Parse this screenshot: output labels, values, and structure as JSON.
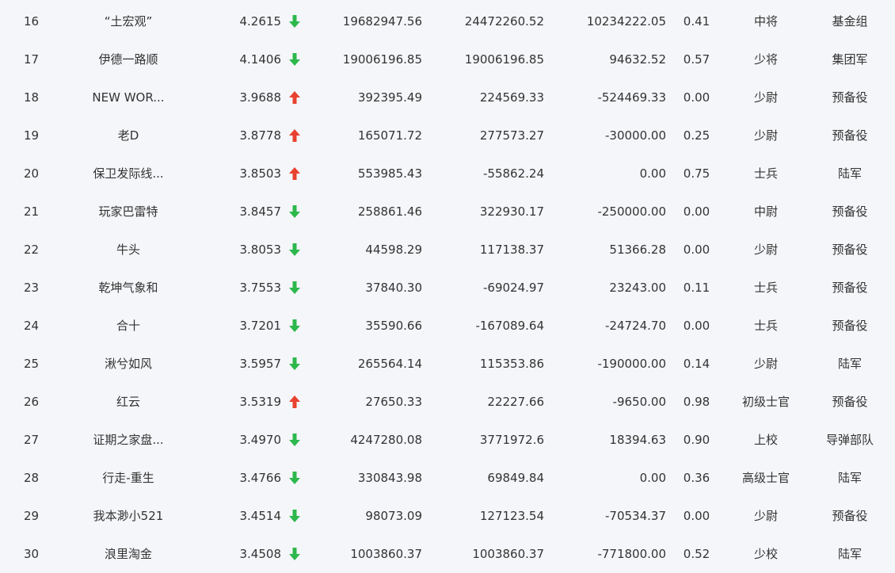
{
  "colors": {
    "up": "#e8412f",
    "down": "#2cb84c"
  },
  "rows": [
    {
      "rank": "16",
      "name": "“土宏观”",
      "score": "4.2615",
      "trend": "down",
      "v1": "19682947.56",
      "v2": "24472260.52",
      "v3": "10234222.05",
      "ratio": "0.41",
      "level": "中将",
      "unit": "基金组"
    },
    {
      "rank": "17",
      "name": "伊德一路顺",
      "score": "4.1406",
      "trend": "down",
      "v1": "19006196.85",
      "v2": "19006196.85",
      "v3": "94632.52",
      "ratio": "0.57",
      "level": "少将",
      "unit": "集团军"
    },
    {
      "rank": "18",
      "name": "NEW WOR...",
      "score": "3.9688",
      "trend": "up",
      "v1": "392395.49",
      "v2": "224569.33",
      "v3": "-524469.33",
      "ratio": "0.00",
      "level": "少尉",
      "unit": "预备役"
    },
    {
      "rank": "19",
      "name": "老D",
      "score": "3.8778",
      "trend": "up",
      "v1": "165071.72",
      "v2": "277573.27",
      "v3": "-30000.00",
      "ratio": "0.25",
      "level": "少尉",
      "unit": "预备役"
    },
    {
      "rank": "20",
      "name": "保卫发际线...",
      "score": "3.8503",
      "trend": "up",
      "v1": "553985.43",
      "v2": "-55862.24",
      "v3": "0.00",
      "ratio": "0.75",
      "level": "士兵",
      "unit": "陆军"
    },
    {
      "rank": "21",
      "name": "玩家巴雷特",
      "score": "3.8457",
      "trend": "down",
      "v1": "258861.46",
      "v2": "322930.17",
      "v3": "-250000.00",
      "ratio": "0.00",
      "level": "中尉",
      "unit": "预备役"
    },
    {
      "rank": "22",
      "name": "牛头",
      "score": "3.8053",
      "trend": "down",
      "v1": "44598.29",
      "v2": "117138.37",
      "v3": "51366.28",
      "ratio": "0.00",
      "level": "少尉",
      "unit": "预备役"
    },
    {
      "rank": "23",
      "name": "乾坤气象和",
      "score": "3.7553",
      "trend": "down",
      "v1": "37840.30",
      "v2": "-69024.97",
      "v3": "23243.00",
      "ratio": "0.11",
      "level": "士兵",
      "unit": "预备役"
    },
    {
      "rank": "24",
      "name": "合十",
      "score": "3.7201",
      "trend": "down",
      "v1": "35590.66",
      "v2": "-167089.64",
      "v3": "-24724.70",
      "ratio": "0.00",
      "level": "士兵",
      "unit": "预备役"
    },
    {
      "rank": "25",
      "name": "湫兮如风",
      "score": "3.5957",
      "trend": "down",
      "v1": "265564.14",
      "v2": "115353.86",
      "v3": "-190000.00",
      "ratio": "0.14",
      "level": "少尉",
      "unit": "陆军"
    },
    {
      "rank": "26",
      "name": "红云",
      "score": "3.5319",
      "trend": "up",
      "v1": "27650.33",
      "v2": "22227.66",
      "v3": "-9650.00",
      "ratio": "0.98",
      "level": "初级士官",
      "unit": "预备役"
    },
    {
      "rank": "27",
      "name": "证期之家盘...",
      "score": "3.4970",
      "trend": "down",
      "v1": "4247280.08",
      "v2": "3771972.6",
      "v3": "18394.63",
      "ratio": "0.90",
      "level": "上校",
      "unit": "导弹部队"
    },
    {
      "rank": "28",
      "name": "行走-重生",
      "score": "3.4766",
      "trend": "down",
      "v1": "330843.98",
      "v2": "69849.84",
      "v3": "0.00",
      "ratio": "0.36",
      "level": "高级士官",
      "unit": "陆军"
    },
    {
      "rank": "29",
      "name": "我本渺小521",
      "score": "3.4514",
      "trend": "down",
      "v1": "98073.09",
      "v2": "127123.54",
      "v3": "-70534.37",
      "ratio": "0.00",
      "level": "少尉",
      "unit": "预备役"
    },
    {
      "rank": "30",
      "name": "浪里淘金",
      "score": "3.4508",
      "trend": "down",
      "v1": "1003860.37",
      "v2": "1003860.37",
      "v3": "-771800.00",
      "ratio": "0.52",
      "level": "少校",
      "unit": "陆军"
    }
  ]
}
